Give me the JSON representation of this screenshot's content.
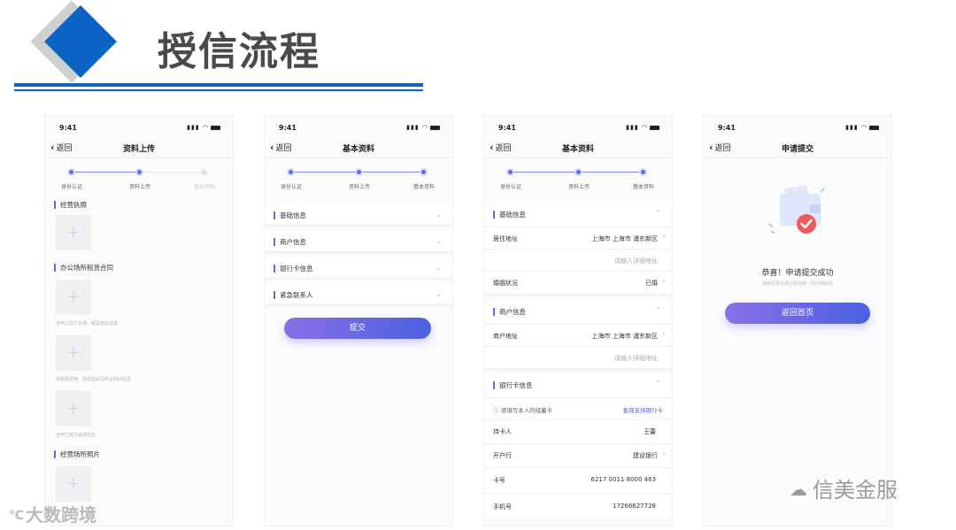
{
  "slide": {
    "title": "授信流程"
  },
  "colors": {
    "accent": "#0a63c5",
    "button_start": "#8a70e6",
    "button_end": "#4b60e2",
    "title_gray": "#4a4a4a"
  },
  "status_bar": {
    "time": "9:41",
    "icons": [
      "signal-icon",
      "wifi-icon",
      "battery-icon"
    ]
  },
  "nav": {
    "back": "返回"
  },
  "steps": [
    "身份认证",
    "资料上传",
    "基本资料"
  ],
  "screen1": {
    "title": "资料上传",
    "sections": [
      "经营执照",
      "办公场所租赁合同",
      "经营场所照片"
    ],
    "hints": [
      "含甲乙双方名称、租赁地址信息",
      "含租赁费用、租赁起始及终止时间信息",
      "含甲乙双方盖章信息"
    ]
  },
  "screen2": {
    "title": "基本资料",
    "rows": [
      "基础信息",
      "商户信息",
      "银行卡信息",
      "紧急联系人"
    ],
    "submit": "提交"
  },
  "screen3": {
    "title": "基本资料",
    "basic": {
      "title": "基础信息",
      "address_label": "居住地址",
      "address_value": "上海市 上海市 浦东新区",
      "detail_placeholder": "请输入详细地址",
      "marital_label": "婚姻状况",
      "marital_value": "已婚"
    },
    "merchant": {
      "title": "商户信息",
      "address_label": "商户地址",
      "address_value": "上海市 上海市 浦东新区",
      "detail_placeholder": "请输入详细地址"
    },
    "bank": {
      "title": "银行卡信息",
      "notice": "请填写本人的储蓄卡",
      "notice_link": "查询支持银行卡",
      "holder_label": "持卡人",
      "holder_value": "王蕾",
      "bank_label": "开户行",
      "bank_value": "建设银行",
      "card_label": "卡号",
      "card_value": "6217 0011 8000 463",
      "phone_label": "手机号",
      "phone_value": "17266627728"
    }
  },
  "screen4": {
    "title": "申请提交",
    "success": "恭喜！申请提交成功",
    "sub": "审核结果将通过短信第一时间通知您",
    "home_button": "返回首页"
  },
  "watermarks": {
    "left": "大数跨境",
    "right": "信美金服"
  }
}
